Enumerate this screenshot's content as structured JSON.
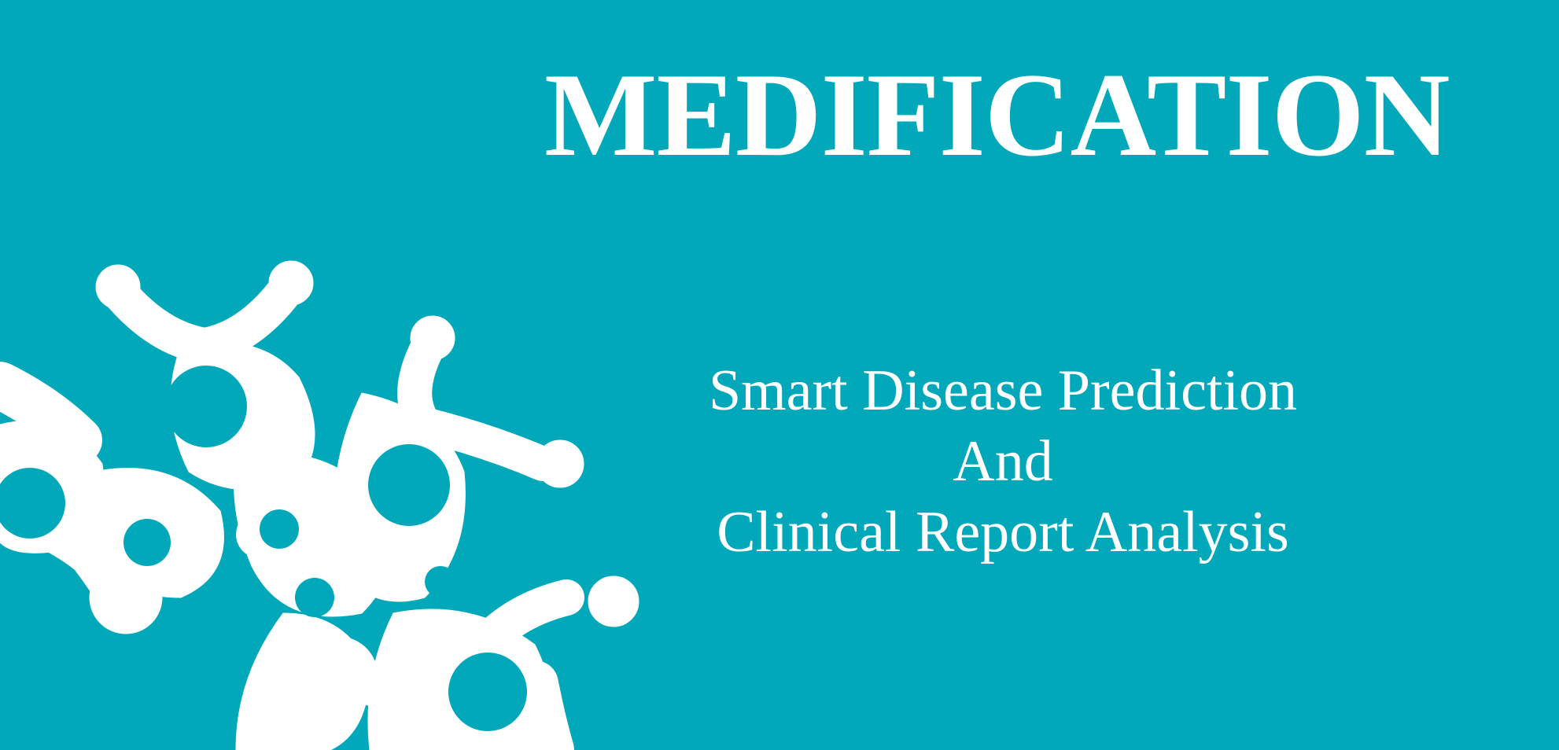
{
  "header": {
    "title": "MEDIFICATION"
  },
  "subtitle": {
    "line1": "Smart Disease Prediction",
    "line2": "And",
    "line3": "Clinical Report Analysis"
  },
  "colors": {
    "background": "#00a8ba",
    "text": "#ffffff",
    "decor": "#ffffff"
  },
  "decor": {
    "icon": "molecule-network-icon"
  }
}
